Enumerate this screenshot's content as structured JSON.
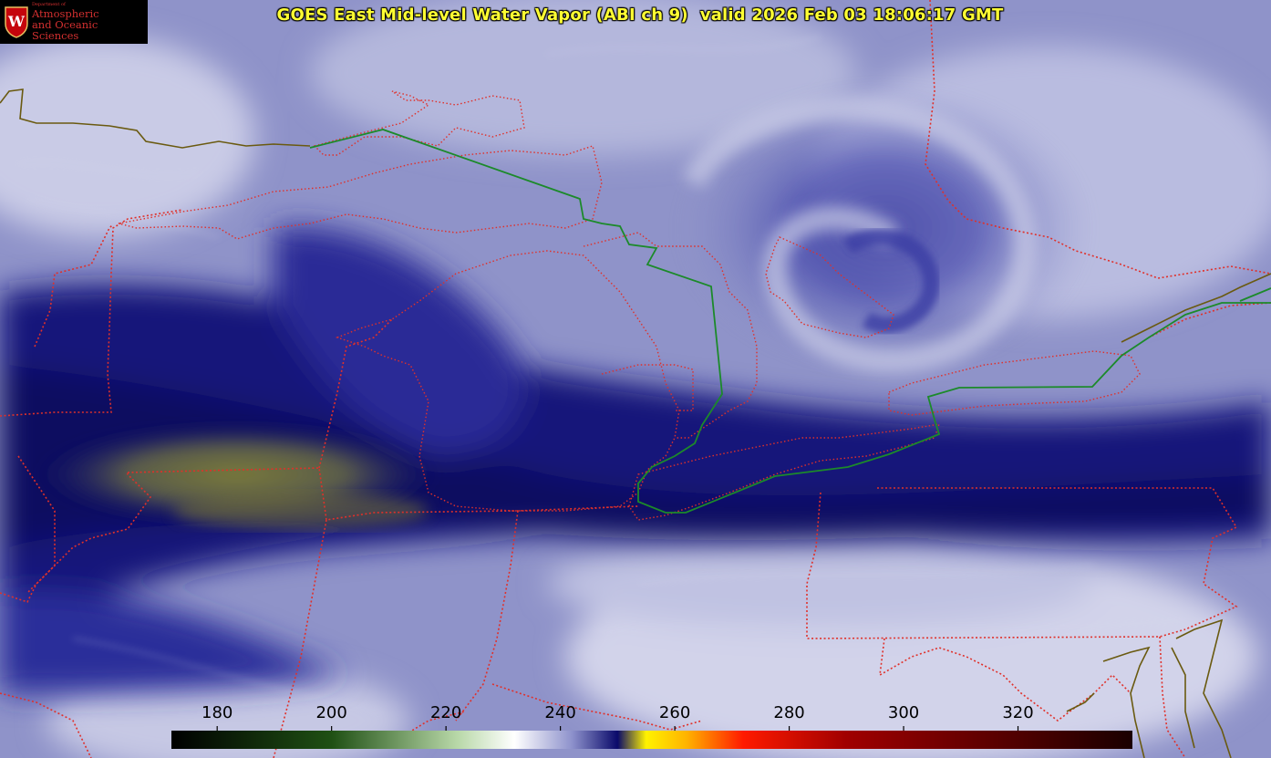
{
  "header": {
    "title": "GOES East Mid-level Water Vapor (ABI ch 9)  valid 2026 Feb 03 18:06:17 GMT"
  },
  "logo": {
    "badge_letter": "W",
    "dept_line": "Department of",
    "line1": "Atmospheric",
    "line2": "and Oceanic Sciences"
  },
  "colorbar": {
    "unit_values": [
      180,
      200,
      220,
      240,
      260,
      280,
      300,
      320
    ],
    "labels": [
      "180",
      "200",
      "220",
      "240",
      "260",
      "280",
      "300",
      "320"
    ],
    "range": [
      172,
      340
    ],
    "stops": [
      {
        "value": 172,
        "color": "#000000"
      },
      {
        "value": 200,
        "color": "#1f5014"
      },
      {
        "value": 222,
        "color": "#b8d8a8"
      },
      {
        "value": 232,
        "color": "#ffffff"
      },
      {
        "value": 242,
        "color": "#8e92cc"
      },
      {
        "value": 250,
        "color": "#0a0a6a"
      },
      {
        "value": 255,
        "color": "#fff200"
      },
      {
        "value": 262,
        "color": "#ffb400"
      },
      {
        "value": 272,
        "color": "#ff1a00"
      },
      {
        "value": 290,
        "color": "#a00000"
      },
      {
        "value": 340,
        "color": "#1a0000"
      }
    ]
  },
  "legend_colors": {
    "state_borders": "#e0302a",
    "country_border": "#1c8a2a",
    "coastline": "#6a5a10",
    "title": "#ffff33"
  }
}
